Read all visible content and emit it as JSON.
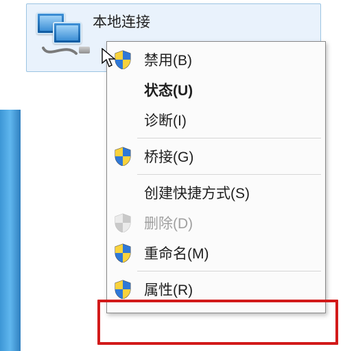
{
  "adapter": {
    "name": "本地连接"
  },
  "menu": {
    "items": [
      {
        "key": "disable",
        "label": "禁用(B)",
        "shield": true,
        "disabled": false,
        "bold": false
      },
      {
        "key": "status",
        "label": "状态(U)",
        "shield": false,
        "disabled": false,
        "bold": true
      },
      {
        "key": "diagnose",
        "label": "诊断(I)",
        "shield": false,
        "disabled": false,
        "bold": false
      },
      {
        "key": "bridge",
        "label": "桥接(G)",
        "shield": true,
        "disabled": false,
        "bold": false
      },
      {
        "key": "shortcut",
        "label": "创建快捷方式(S)",
        "shield": false,
        "disabled": false,
        "bold": false
      },
      {
        "key": "delete",
        "label": "删除(D)",
        "shield": true,
        "disabled": true,
        "bold": false
      },
      {
        "key": "rename",
        "label": "重命名(M)",
        "shield": true,
        "disabled": false,
        "bold": false
      },
      {
        "key": "props",
        "label": "属性(R)",
        "shield": true,
        "disabled": false,
        "bold": false
      }
    ]
  },
  "colors": {
    "highlight_border": "#d21a1a",
    "selection_bg": "#e9f2fc",
    "selection_border": "#9bc4e2"
  }
}
